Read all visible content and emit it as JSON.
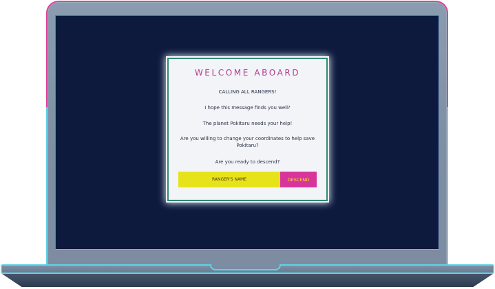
{
  "dialog": {
    "title": "WELCOME ABOARD",
    "messages": [
      "CALLING ALL RANGERS!",
      "I hope this message finds you well?",
      "The planet Pokitaru needs your help!",
      "Are you willing to change your coordinates to help save Pokitaru?",
      "Are you ready to descend?"
    ],
    "name_input": {
      "placeholder": "RANGER'S NAME",
      "value": ""
    },
    "descend_label": "DESCEND"
  },
  "colors": {
    "screen_bg": "#0d1a3d",
    "dialog_bg": "#f2f4f7",
    "title": "#b43a8e",
    "input_bg": "#e7e31a",
    "button_bg": "#d8359c",
    "button_text": "#f3e31c",
    "frame_pink": "#e0429a",
    "frame_cyan": "#5fd3e6"
  }
}
